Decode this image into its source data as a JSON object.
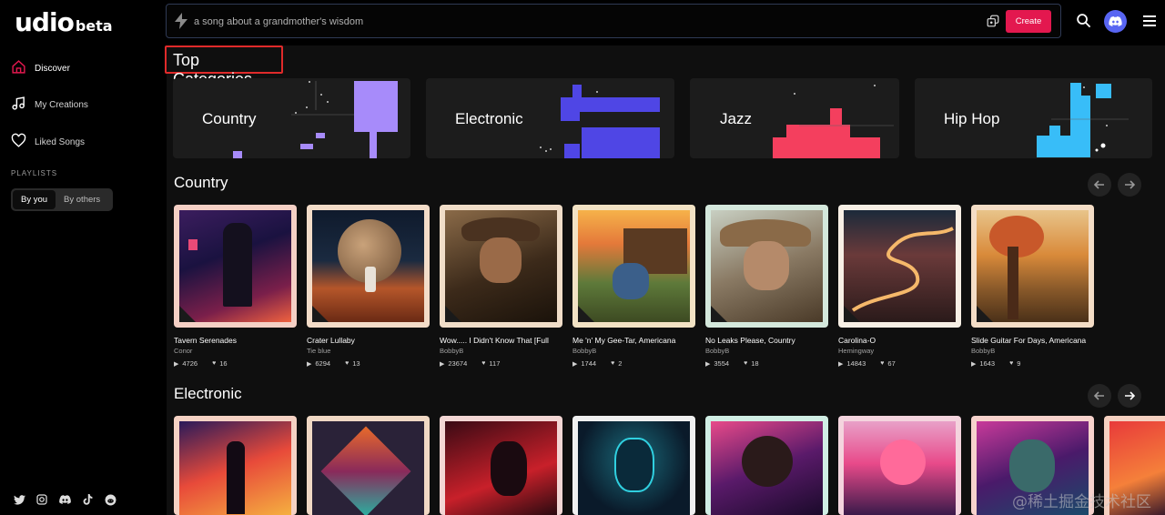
{
  "brand": {
    "name": "udio",
    "tag": "beta"
  },
  "sidebar": {
    "items": [
      {
        "label": "Discover"
      },
      {
        "label": "My Creations"
      },
      {
        "label": "Liked Songs"
      }
    ],
    "playlists_label": "PLAYLISTS",
    "toggle": [
      "By you",
      "By others"
    ]
  },
  "search": {
    "placeholder": "a song about a grandmother's wisdom",
    "create_label": "Create"
  },
  "top_categories": {
    "title": "Top Categories",
    "items": [
      "Country",
      "Electronic",
      "Jazz",
      "Hip Hop"
    ]
  },
  "sections": [
    {
      "title": "Country",
      "songs": [
        {
          "title": "Tavern Serenades",
          "artist": "Conor",
          "plays": "4726",
          "likes": "16"
        },
        {
          "title": "Crater Lullaby",
          "artist": "Tie blue",
          "plays": "6294",
          "likes": "13"
        },
        {
          "title": "Wow..... I Didn't Know That [Full",
          "artist": "BobbyB",
          "plays": "23674",
          "likes": "117"
        },
        {
          "title": "Me 'n' My Gee-Tar, Americana",
          "artist": "BobbyB",
          "plays": "1744",
          "likes": "2"
        },
        {
          "title": "No Leaks Please, Country",
          "artist": "BobbyB",
          "plays": "3554",
          "likes": "18"
        },
        {
          "title": "Carolina-O",
          "artist": "Hemingway",
          "plays": "14843",
          "likes": "67"
        },
        {
          "title": "Slide Guitar For Days, Americana",
          "artist": "BobbyB",
          "plays": "1643",
          "likes": "9"
        }
      ]
    },
    {
      "title": "Electronic",
      "songs": []
    }
  ],
  "watermark": "@稀土掘金技术社区",
  "colors": {
    "accent": "#e3184f",
    "discord": "#5865f2",
    "country": "#a78bfa",
    "electronic": "#4f46e5",
    "jazz": "#f43f5e",
    "hiphop": "#38bdf8"
  }
}
